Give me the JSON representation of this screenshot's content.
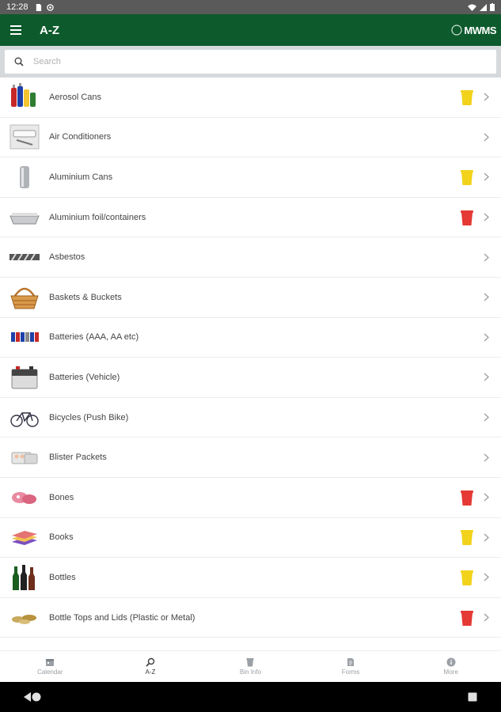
{
  "status_bar": {
    "time": "12:28"
  },
  "app_bar": {
    "title": "A-Z",
    "logo_text": "MWMS"
  },
  "search": {
    "placeholder": "Search"
  },
  "items": [
    {
      "label": "Aerosol Cans",
      "icon": "aerosol-cans-image",
      "bin": "yellow"
    },
    {
      "label": "Air Conditioners",
      "icon": "air-conditioner-image",
      "bin": ""
    },
    {
      "label": "Aluminium Cans",
      "icon": "aluminium-can-image",
      "bin": "yellow"
    },
    {
      "label": "Aluminium foil/containers",
      "icon": "foil-container-image",
      "bin": "red"
    },
    {
      "label": "Asbestos",
      "icon": "asbestos-image",
      "bin": ""
    },
    {
      "label": "Baskets & Buckets",
      "icon": "basket-image",
      "bin": ""
    },
    {
      "label": "Batteries (AAA, AA etc)",
      "icon": "batteries-image",
      "bin": ""
    },
    {
      "label": "Batteries (Vehicle)",
      "icon": "car-battery-image",
      "bin": ""
    },
    {
      "label": "Bicycles (Push Bike)",
      "icon": "bicycle-image",
      "bin": ""
    },
    {
      "label": "Blister Packets",
      "icon": "blister-packet-image",
      "bin": ""
    },
    {
      "label": "Bones",
      "icon": "bones-image",
      "bin": "red"
    },
    {
      "label": "Books",
      "icon": "books-image",
      "bin": "yellow"
    },
    {
      "label": "Bottles",
      "icon": "bottles-image",
      "bin": "yellow"
    },
    {
      "label": "Bottle Tops and Lids (Plastic or Metal)",
      "icon": "bottle-tops-image",
      "bin": "red"
    }
  ],
  "bottom_nav": [
    {
      "label": "Calendar",
      "icon": "calendar-icon",
      "active": false
    },
    {
      "label": "A-Z",
      "icon": "search-icon",
      "active": true
    },
    {
      "label": "Bin Info",
      "icon": "bin-icon",
      "active": false
    },
    {
      "label": "Forms",
      "icon": "form-icon",
      "active": false
    },
    {
      "label": "More",
      "icon": "info-icon",
      "active": false
    }
  ],
  "colors": {
    "app_bar": "#0d5a2c",
    "yellow_bin": "#f2d21b",
    "red_bin": "#e53935",
    "search_bg": "#d6d9dc"
  }
}
